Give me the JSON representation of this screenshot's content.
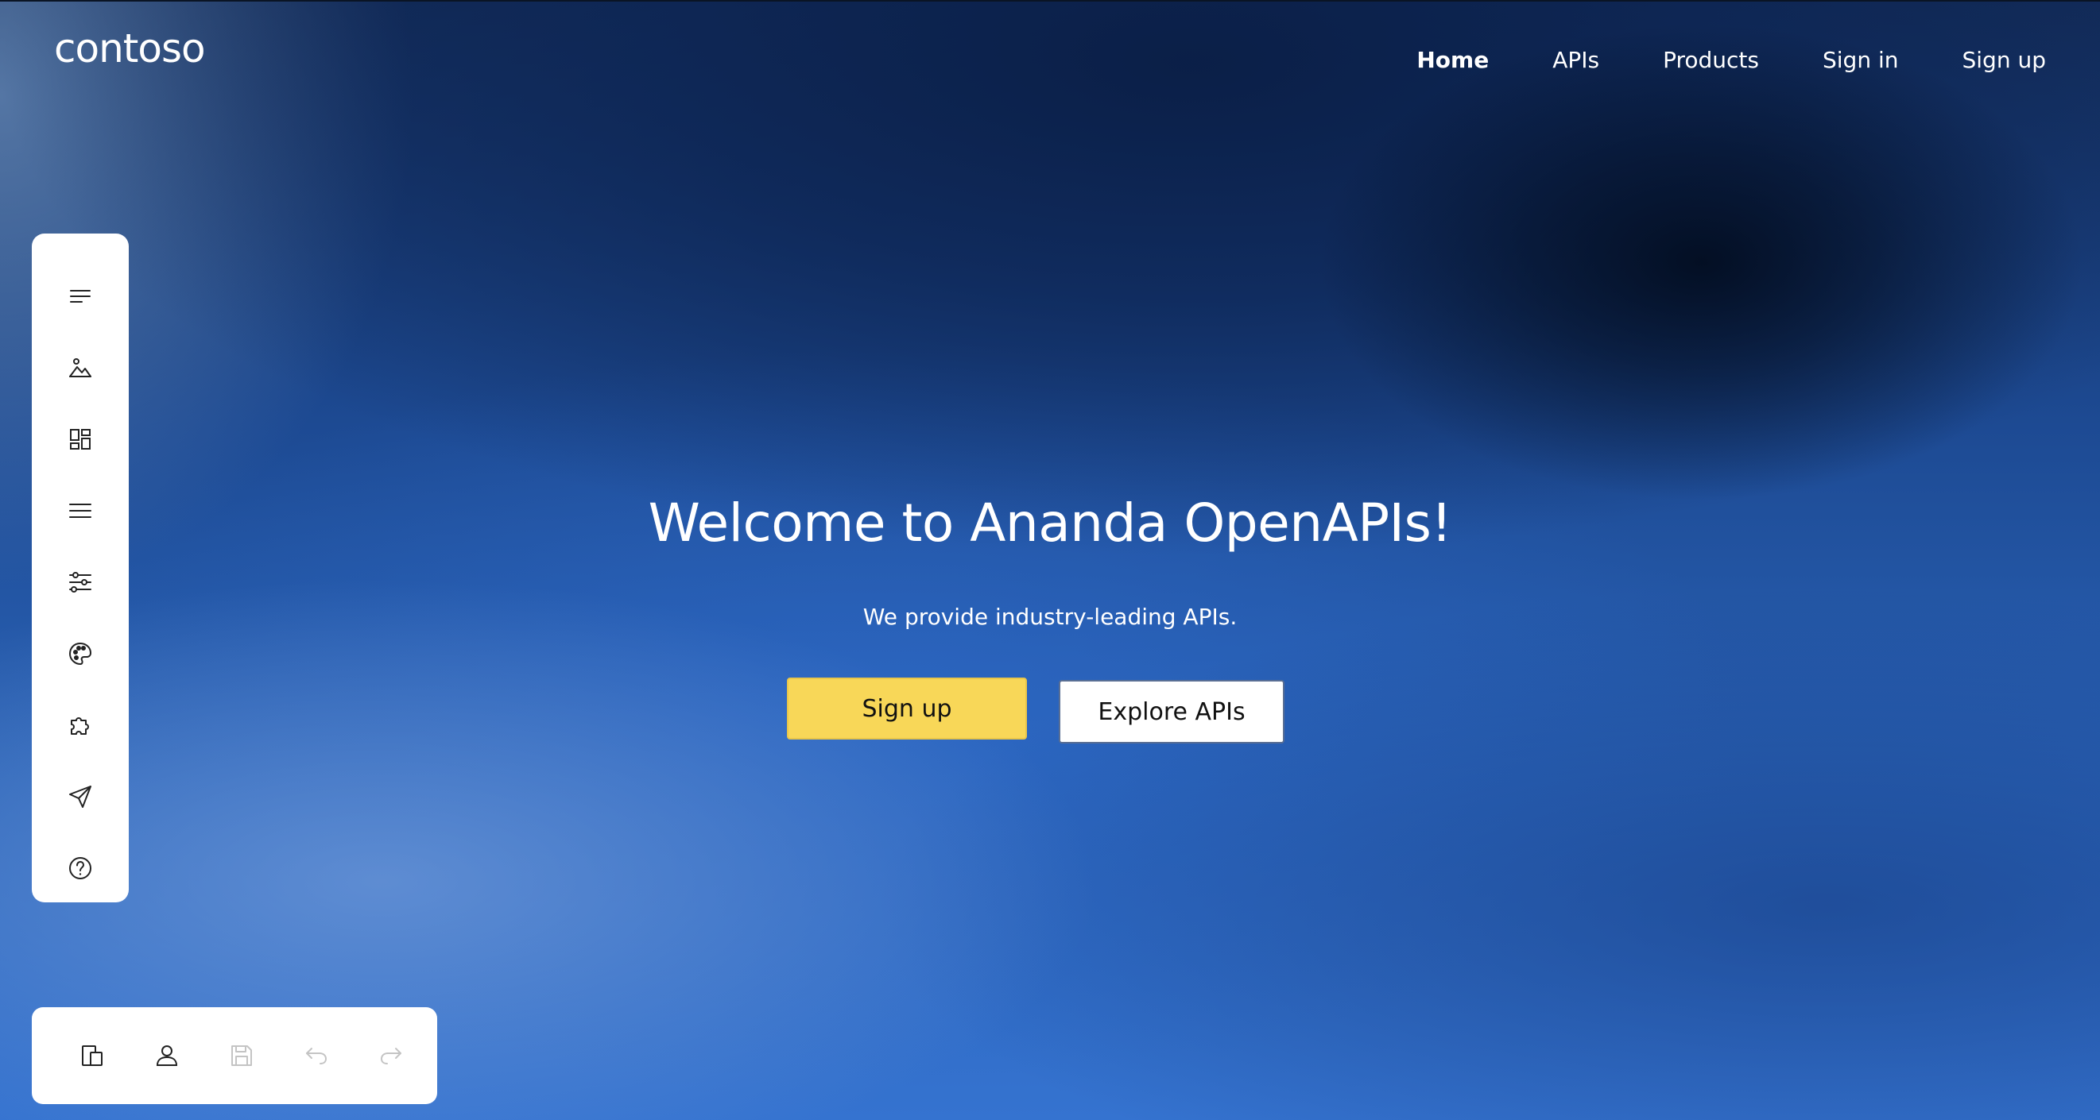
{
  "brand": {
    "logo_text": "contoso"
  },
  "nav": {
    "items": [
      {
        "label": "Home",
        "active": true
      },
      {
        "label": "APIs",
        "active": false
      },
      {
        "label": "Products",
        "active": false
      },
      {
        "label": "Sign in",
        "active": false
      },
      {
        "label": "Sign up",
        "active": false
      }
    ]
  },
  "hero": {
    "title": "Welcome to Ananda OpenAPIs!",
    "subtitle": "We provide industry-leading APIs.",
    "primary_button": "Sign up",
    "secondary_button": "Explore APIs"
  },
  "side_toolbar": {
    "icons": [
      "text-icon",
      "image-icon",
      "widgets-icon",
      "menu-icon",
      "sliders-icon",
      "palette-icon",
      "puzzle-icon",
      "send-icon",
      "help-icon"
    ]
  },
  "bottom_toolbar": {
    "icons": [
      {
        "name": "pages-icon",
        "enabled": true
      },
      {
        "name": "user-icon",
        "enabled": true
      },
      {
        "name": "save-icon",
        "enabled": false
      },
      {
        "name": "undo-icon",
        "enabled": false
      },
      {
        "name": "redo-icon",
        "enabled": false
      }
    ]
  },
  "colors": {
    "primary_button": "#f8d758",
    "toolbar_bg": "#ffffff",
    "icon_color": "#222222",
    "icon_disabled": "#c4c4c4"
  }
}
